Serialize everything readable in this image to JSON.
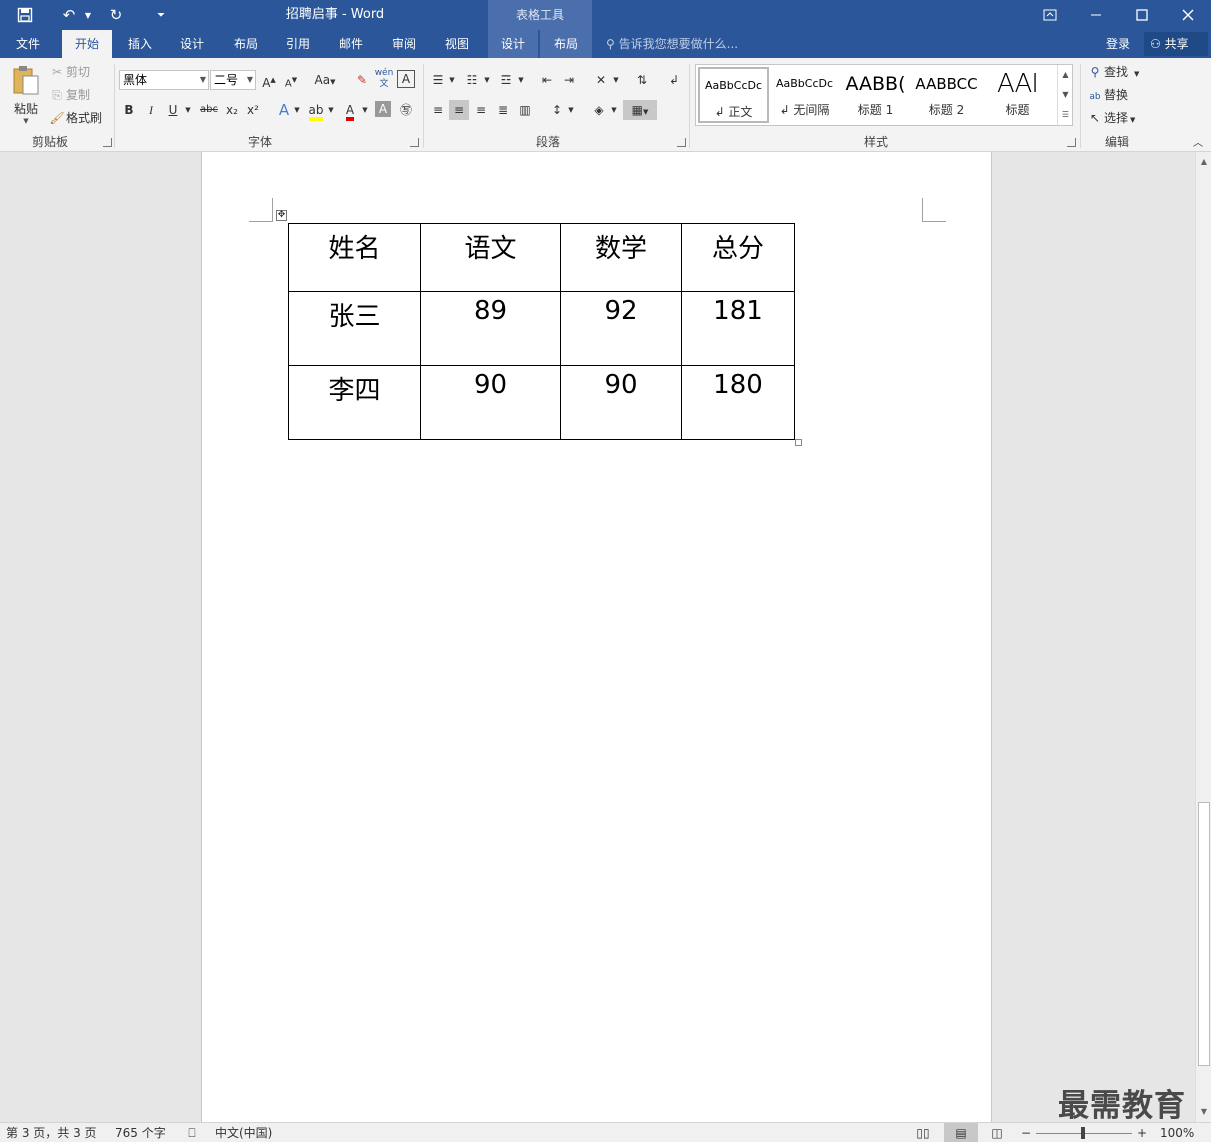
{
  "title_bar": {
    "document_title": "招聘启事 - Word",
    "contextual_header": "表格工具"
  },
  "tabs": {
    "file": "文件",
    "home": "开始",
    "insert": "插入",
    "design": "设计",
    "layout": "布局",
    "references": "引用",
    "mailings": "邮件",
    "review": "审阅",
    "view": "视图",
    "table_design": "设计",
    "table_layout": "布局",
    "tell_me": "告诉我您想要做什么...",
    "login": "登录",
    "share": "共享"
  },
  "ribbon": {
    "clipboard": {
      "label": "剪贴板",
      "paste": "粘贴",
      "cut": "剪切",
      "copy": "复制",
      "format_painter": "格式刷"
    },
    "font": {
      "label": "字体",
      "font_name": "黑体",
      "font_size": "二号",
      "bold": "B",
      "italic": "I",
      "underline": "U",
      "strikethrough": "abc",
      "subscript": "x₂",
      "superscript": "x²",
      "change_case": "Aa"
    },
    "paragraph": {
      "label": "段落"
    },
    "styles": {
      "label": "样式",
      "items": [
        {
          "preview": "AaBbCcDc",
          "name": "↲ 正文"
        },
        {
          "preview": "AaBbCcDc",
          "name": "↲ 无间隔"
        },
        {
          "preview": "AABB(",
          "name": "标题 1"
        },
        {
          "preview": "AABBCC",
          "name": "标题 2"
        },
        {
          "preview": "AAI",
          "name": "标题"
        }
      ]
    },
    "editing": {
      "label": "编辑",
      "find": "查找",
      "replace": "替换",
      "select": "选择"
    }
  },
  "table": {
    "header": [
      "姓名",
      "语文",
      "数学",
      "总分"
    ],
    "rows": [
      [
        "张三",
        "89",
        "92",
        "181"
      ],
      [
        "李四",
        "90",
        "90",
        "180"
      ]
    ]
  },
  "status_bar": {
    "page": "第 3 页，共 3 页",
    "words": "765 个字",
    "language": "中文(中国)",
    "zoom": "100%"
  },
  "watermark": "最需教育"
}
